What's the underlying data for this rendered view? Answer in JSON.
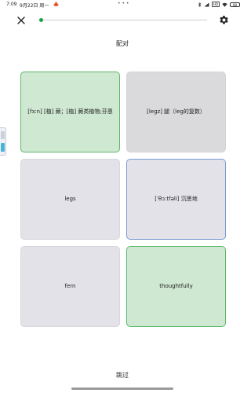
{
  "status_bar": {
    "time": "7:09",
    "date": "9月22日 周一",
    "dots": "• • •",
    "badge": "HD",
    "battery": "88"
  },
  "header": {
    "title": "配对",
    "progress_fraction": 0.02
  },
  "cards": [
    {
      "text": "[fɜːn] [植] 蕨；[植] 蕨类植物;芬恩",
      "state": "matched"
    },
    {
      "text": "[legz] 腿（leg的复数）",
      "state": "dim"
    },
    {
      "text": "legs",
      "state": "neutral"
    },
    {
      "text": "[ˈθɔːtfəli] 沉思地",
      "state": "selected"
    },
    {
      "text": "fern",
      "state": "neutral"
    },
    {
      "text": "thoughtfully",
      "state": "matched"
    }
  ],
  "footer": {
    "skip_label": "跳过"
  },
  "colors": {
    "matched_bg": "#cfe8d2",
    "matched_border": "#5cb86b",
    "selected_border": "#7a9bd3",
    "progress": "#1aa34a"
  }
}
